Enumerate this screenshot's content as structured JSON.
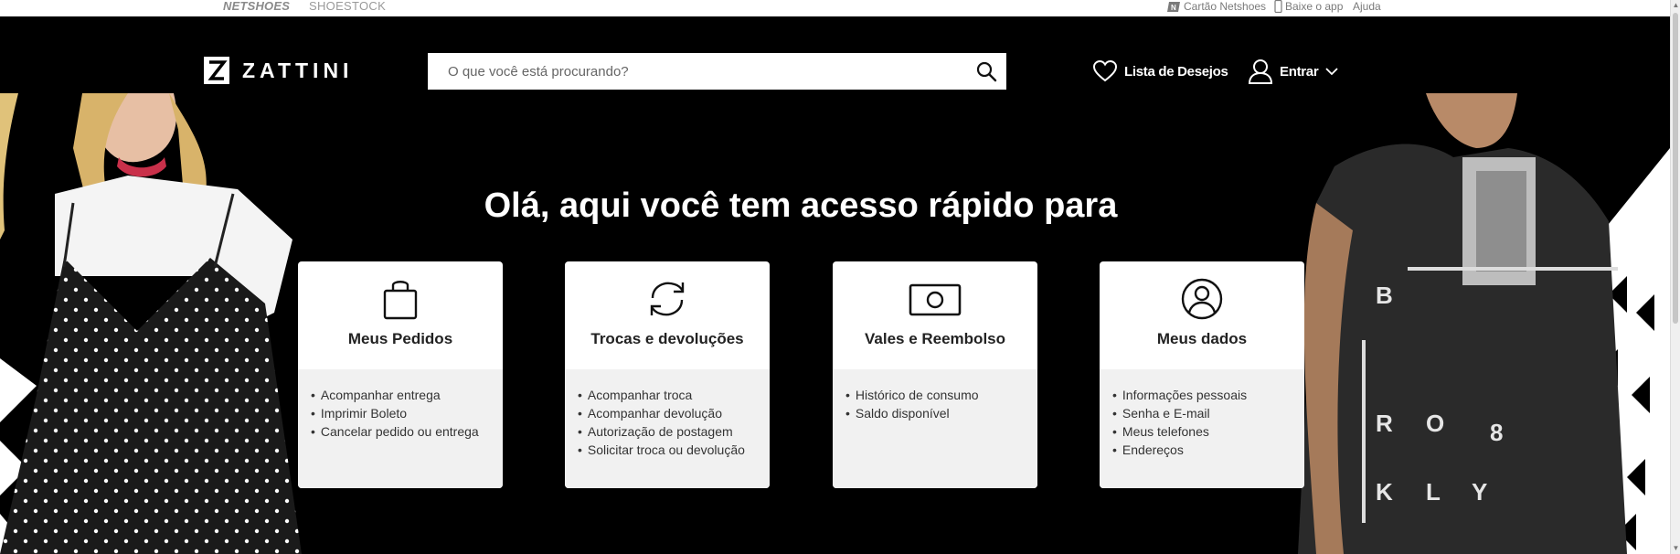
{
  "top_bar": {
    "brands": [
      "NETSHOES",
      "SHOESTOCK"
    ],
    "cartao": "Cartão Netshoes",
    "app": "Baixe o app",
    "help": "Ajuda"
  },
  "header": {
    "logo": "ZATTINI",
    "search_placeholder": "O que você está procurando?",
    "wishlist": "Lista de Desejos",
    "login": "Entrar"
  },
  "hero": {
    "title": "Olá, aqui você tem acesso rápido para",
    "cards": [
      {
        "title": "Meus Pedidos",
        "icon": "shopping-bag-icon",
        "items": [
          "Acompanhar entrega",
          "Imprimir Boleto",
          "Cancelar pedido ou entrega"
        ]
      },
      {
        "title": "Trocas e devoluções",
        "icon": "exchange-arrows-icon",
        "items": [
          "Acompanhar troca",
          "Acompanhar devolução",
          "Autorização de postagem",
          "Solicitar troca ou devolução"
        ]
      },
      {
        "title": "Vales e Reembolso",
        "icon": "money-bill-icon",
        "items": [
          "Histórico de consumo",
          "Saldo disponível"
        ]
      },
      {
        "title": "Meus dados",
        "icon": "user-circle-icon",
        "items": [
          "Informações pessoais",
          "Senha e E-mail",
          "Meus telefones",
          "Endereços"
        ]
      }
    ]
  },
  "colors": {
    "header_bg": "#000000",
    "card_bg": "#ffffff",
    "list_bg": "#f1f1f1",
    "text_light": "#ffffff"
  }
}
